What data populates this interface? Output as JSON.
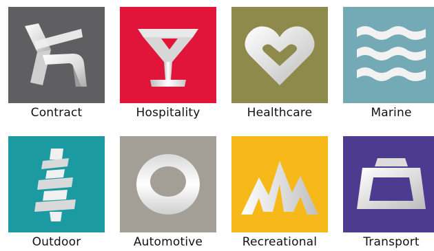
{
  "categories": [
    {
      "label": "Contract",
      "icon": "chair-ribbon-icon",
      "color": "#5f5f62"
    },
    {
      "label": "Hospitality",
      "icon": "cocktail-glass-icon",
      "color": "#e1153a"
    },
    {
      "label": "Healthcare",
      "icon": "heart-icon",
      "color": "#8e8a4c"
    },
    {
      "label": "Marine",
      "icon": "waves-icon",
      "color": "#74aab6"
    },
    {
      "label": "Outdoor",
      "icon": "tree-ribbon-icon",
      "color": "#1b9ba1"
    },
    {
      "label": "Automotive",
      "icon": "ring-icon",
      "color": "#a39f97"
    },
    {
      "label": "Recreational",
      "icon": "mountains-icon",
      "color": "#f7b919"
    },
    {
      "label": "Transport",
      "icon": "bag-icon",
      "color": "#4c3b8f"
    }
  ]
}
